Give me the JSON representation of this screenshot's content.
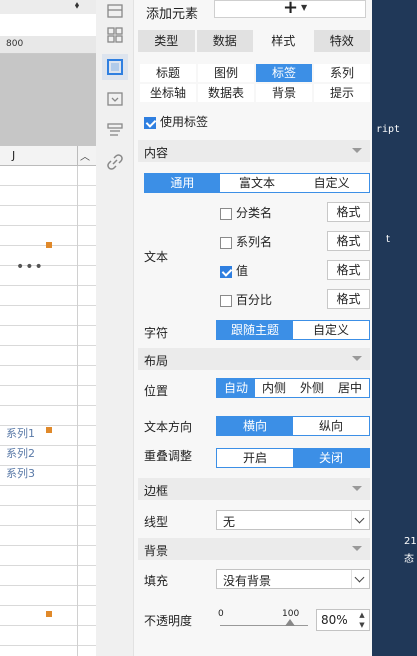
{
  "sheet": {
    "ruler_label": "800",
    "column_header": "J",
    "more_dots": "•••",
    "series_labels": [
      "系列1",
      "系列2",
      "系列3"
    ]
  },
  "right_area": {
    "text1": "ript",
    "text2": "t",
    "text3": "21",
    "text4": "态"
  },
  "panel": {
    "add_element_label": "添加元素",
    "main_tabs": [
      "类型",
      "数据",
      "样式",
      "特效"
    ],
    "main_tab_active": "样式",
    "sub_tabs": [
      "标题",
      "图例",
      "标签",
      "系列",
      "坐标轴",
      "数据表",
      "背景",
      "提示"
    ],
    "sub_tab_active": "标签",
    "use_label": {
      "text": "使用标签",
      "checked": true
    },
    "content": {
      "section_title": "内容",
      "mode_options": [
        "通用",
        "富文本",
        "自定义"
      ],
      "mode_active": "通用",
      "text_label": "文本",
      "items": [
        {
          "label": "分类名",
          "checked": false,
          "format": "格式"
        },
        {
          "label": "系列名",
          "checked": false,
          "format": "格式"
        },
        {
          "label": "值",
          "checked": true,
          "format": "格式"
        },
        {
          "label": "百分比",
          "checked": false,
          "format": "格式"
        }
      ],
      "char_label": "字符",
      "char_options": [
        "跟随主题",
        "自定义"
      ],
      "char_active": "跟随主题"
    },
    "layout": {
      "section_title": "布局",
      "position_label": "位置",
      "position_options": [
        "自动",
        "内侧",
        "外侧",
        "居中"
      ],
      "position_active": "自动",
      "direction_label": "文本方向",
      "direction_options": [
        "横向",
        "纵向"
      ],
      "direction_active": "横向",
      "overlap_label": "重叠调整",
      "overlap_options": [
        "开启",
        "关闭"
      ],
      "overlap_active": "关闭"
    },
    "border": {
      "section_title": "边框",
      "line_label": "线型",
      "line_value": "无"
    },
    "background": {
      "section_title": "背景",
      "fill_label": "填充",
      "fill_value": "没有背景",
      "opacity_label": "不透明度",
      "slider_min": "0",
      "slider_max": "100",
      "opacity_value": "80%",
      "opacity_fraction": 0.8
    }
  },
  "colors": {
    "accent": "#3c8fe6",
    "right_area_bg": "#203858",
    "handle": "#e0892a"
  }
}
